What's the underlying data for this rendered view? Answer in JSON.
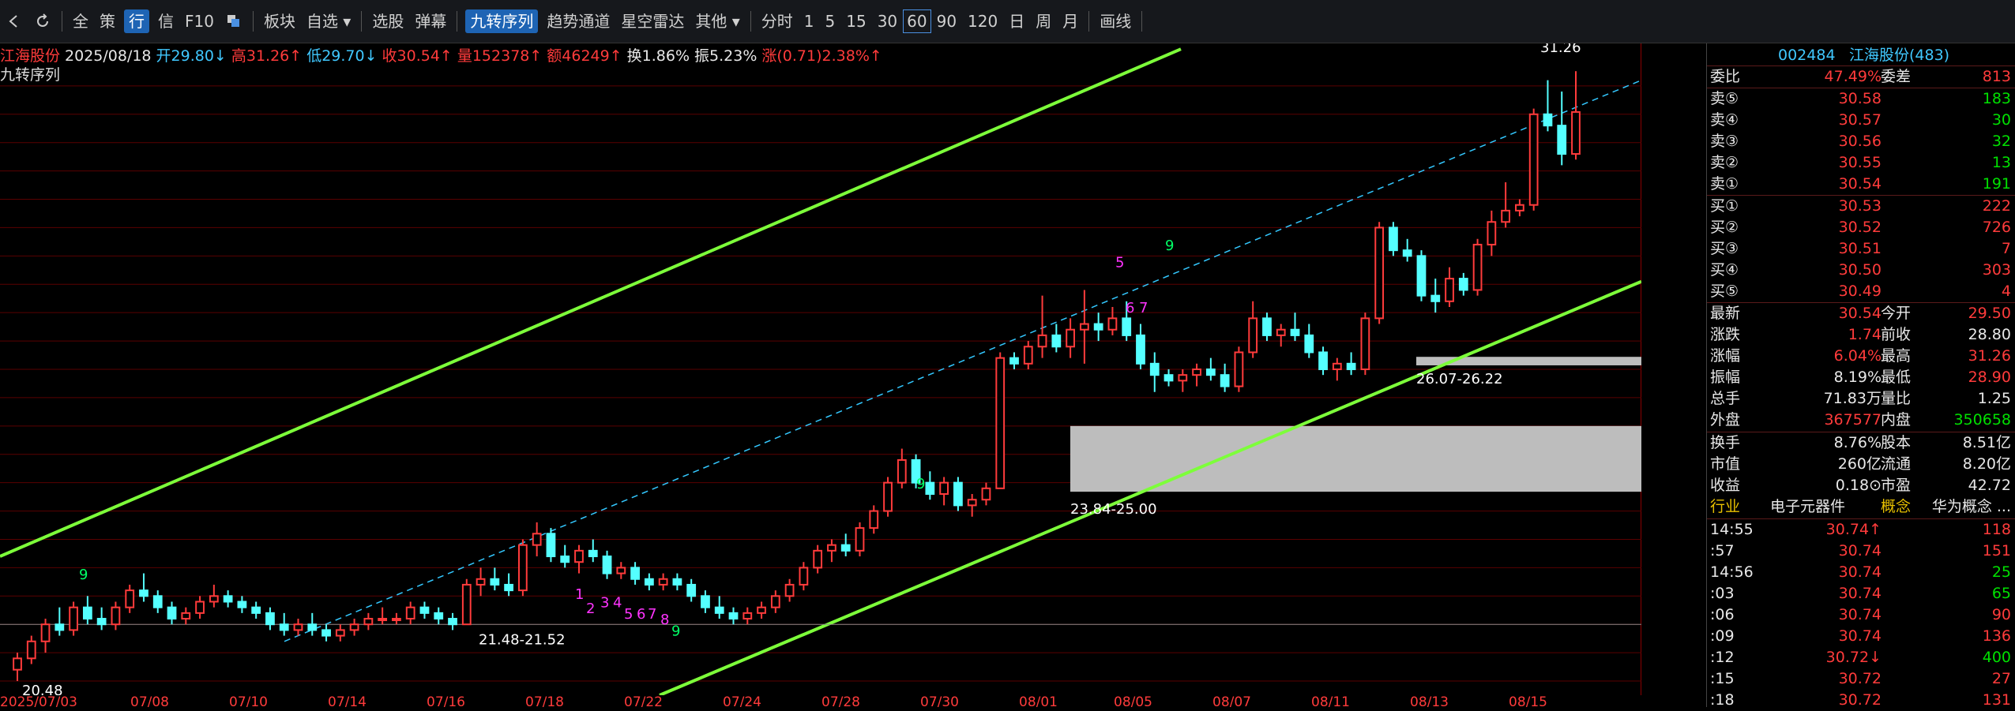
{
  "toolbar": {
    "items": [
      "全",
      "策",
      "行",
      "信",
      "F10"
    ],
    "menu": [
      "板块",
      "自选 ▾"
    ],
    "tools": [
      "选股",
      "弹幕"
    ],
    "indicators": [
      "九转序列",
      "趋势通道",
      "星空雷达",
      "其他 ▾"
    ],
    "periods": [
      "分时",
      "1",
      "5",
      "15",
      "30",
      "60",
      "90",
      "120",
      "日",
      "周",
      "月"
    ],
    "draw": "画线",
    "selected_period": "60",
    "selected_indicator": "九转序列"
  },
  "info": {
    "name": "江海股份",
    "date": "2025/08/18",
    "open": "开29.80↓",
    "high": "高31.26↑",
    "low": "低29.70↓",
    "close": "收30.54↑",
    "volume": "量152378↑",
    "amount": "额46249↑",
    "turnover": "换1.86%",
    "amplitude": "振5.23%",
    "change": "涨(0.71)2.38%↑",
    "indicator": "九转序列"
  },
  "chart_data": {
    "type": "candlestick",
    "ylim": [
      20.25,
      31.75
    ],
    "yticks": [
      "31.00",
      "30.50",
      "30.00",
      "29.50",
      "29.00",
      "28.50",
      "28.00",
      "27.50",
      "27.00",
      "26.50",
      "26.00",
      "25.50",
      "25.00",
      "24.50",
      "24.00",
      "23.50",
      "23.00",
      "22.50",
      "22.00",
      "21.50",
      "21.00",
      "20.50"
    ],
    "dates": [
      "2025/07/03",
      "07/08",
      "07/10",
      "07/14",
      "07/16",
      "07/18",
      "07/22",
      "07/24",
      "07/28",
      "07/30",
      "08/01",
      "08/05",
      "08/07",
      "08/11",
      "08/13",
      "08/15"
    ],
    "current_price": "30.54",
    "period_label": "60分钟",
    "candles": [
      [
        20.7,
        21.0,
        20.5,
        20.9
      ],
      [
        20.9,
        21.3,
        20.8,
        21.2
      ],
      [
        21.2,
        21.6,
        21.0,
        21.5
      ],
      [
        21.5,
        21.8,
        21.3,
        21.4
      ],
      [
        21.4,
        21.9,
        21.3,
        21.8
      ],
      [
        21.8,
        22.0,
        21.5,
        21.6
      ],
      [
        21.6,
        21.8,
        21.4,
        21.5
      ],
      [
        21.5,
        21.9,
        21.4,
        21.8
      ],
      [
        21.8,
        22.2,
        21.7,
        22.1
      ],
      [
        22.1,
        22.4,
        21.9,
        22.0
      ],
      [
        22.0,
        22.1,
        21.7,
        21.8
      ],
      [
        21.8,
        21.9,
        21.5,
        21.6
      ],
      [
        21.6,
        21.8,
        21.5,
        21.7
      ],
      [
        21.7,
        22.0,
        21.6,
        21.9
      ],
      [
        21.9,
        22.2,
        21.8,
        22.0
      ],
      [
        22.0,
        22.1,
        21.8,
        21.9
      ],
      [
        21.9,
        22.0,
        21.7,
        21.8
      ],
      [
        21.8,
        21.9,
        21.6,
        21.7
      ],
      [
        21.7,
        21.8,
        21.4,
        21.5
      ],
      [
        21.5,
        21.7,
        21.3,
        21.4
      ],
      [
        21.4,
        21.6,
        21.3,
        21.5
      ],
      [
        21.5,
        21.7,
        21.3,
        21.4
      ],
      [
        21.4,
        21.5,
        21.2,
        21.3
      ],
      [
        21.3,
        21.5,
        21.2,
        21.4
      ],
      [
        21.4,
        21.6,
        21.3,
        21.5
      ],
      [
        21.5,
        21.7,
        21.4,
        21.6
      ],
      [
        21.6,
        21.8,
        21.5,
        21.6
      ],
      [
        21.6,
        21.7,
        21.5,
        21.6
      ],
      [
        21.6,
        21.9,
        21.5,
        21.8
      ],
      [
        21.8,
        21.9,
        21.6,
        21.7
      ],
      [
        21.7,
        21.8,
        21.5,
        21.6
      ],
      [
        21.6,
        21.7,
        21.4,
        21.5
      ],
      [
        21.5,
        22.3,
        21.5,
        22.2
      ],
      [
        22.2,
        22.5,
        22.0,
        22.3
      ],
      [
        22.3,
        22.5,
        22.1,
        22.2
      ],
      [
        22.2,
        22.4,
        22.0,
        22.1
      ],
      [
        22.1,
        23.0,
        22.0,
        22.9
      ],
      [
        22.9,
        23.3,
        22.7,
        23.1
      ],
      [
        23.1,
        23.2,
        22.6,
        22.7
      ],
      [
        22.7,
        22.9,
        22.5,
        22.6
      ],
      [
        22.6,
        22.9,
        22.4,
        22.8
      ],
      [
        22.8,
        23.0,
        22.6,
        22.7
      ],
      [
        22.7,
        22.8,
        22.3,
        22.4
      ],
      [
        22.4,
        22.6,
        22.3,
        22.5
      ],
      [
        22.5,
        22.6,
        22.2,
        22.3
      ],
      [
        22.3,
        22.4,
        22.1,
        22.2
      ],
      [
        22.2,
        22.4,
        22.1,
        22.3
      ],
      [
        22.3,
        22.4,
        22.1,
        22.2
      ],
      [
        22.2,
        22.3,
        21.9,
        22.0
      ],
      [
        22.0,
        22.1,
        21.7,
        21.8
      ],
      [
        21.8,
        22.0,
        21.6,
        21.7
      ],
      [
        21.7,
        21.8,
        21.5,
        21.6
      ],
      [
        21.6,
        21.8,
        21.5,
        21.7
      ],
      [
        21.7,
        21.9,
        21.6,
        21.8
      ],
      [
        21.8,
        22.1,
        21.7,
        22.0
      ],
      [
        22.0,
        22.3,
        21.9,
        22.2
      ],
      [
        22.2,
        22.6,
        22.1,
        22.5
      ],
      [
        22.5,
        22.9,
        22.4,
        22.8
      ],
      [
        22.8,
        23.0,
        22.6,
        22.9
      ],
      [
        22.9,
        23.1,
        22.7,
        22.8
      ],
      [
        22.8,
        23.3,
        22.7,
        23.2
      ],
      [
        23.2,
        23.6,
        23.1,
        23.5
      ],
      [
        23.5,
        24.1,
        23.4,
        24.0
      ],
      [
        24.0,
        24.6,
        23.9,
        24.4
      ],
      [
        24.4,
        24.5,
        23.9,
        24.0
      ],
      [
        24.0,
        24.2,
        23.7,
        23.8
      ],
      [
        23.8,
        24.1,
        23.6,
        24.0
      ],
      [
        24.0,
        24.1,
        23.5,
        23.6
      ],
      [
        23.6,
        23.8,
        23.4,
        23.7
      ],
      [
        23.7,
        24.0,
        23.6,
        23.9
      ],
      [
        23.9,
        26.3,
        24.8,
        26.2
      ],
      [
        26.2,
        26.3,
        26.0,
        26.1
      ],
      [
        26.1,
        26.5,
        26.0,
        26.4
      ],
      [
        26.4,
        27.3,
        26.2,
        26.6
      ],
      [
        26.6,
        26.8,
        26.3,
        26.4
      ],
      [
        26.4,
        26.9,
        26.2,
        26.7
      ],
      [
        26.7,
        27.4,
        26.1,
        26.8
      ],
      [
        26.8,
        27.0,
        26.5,
        26.7
      ],
      [
        26.7,
        27.1,
        26.6,
        26.9
      ],
      [
        26.9,
        27.2,
        26.5,
        26.6
      ],
      [
        26.6,
        26.8,
        26.0,
        26.1
      ],
      [
        26.1,
        26.3,
        25.6,
        25.9
      ],
      [
        25.9,
        26.0,
        25.7,
        25.8
      ],
      [
        25.8,
        26.0,
        25.6,
        25.9
      ],
      [
        25.9,
        26.1,
        25.7,
        26.0
      ],
      [
        26.0,
        26.2,
        25.8,
        25.9
      ],
      [
        25.9,
        26.1,
        25.6,
        25.7
      ],
      [
        25.7,
        26.4,
        25.6,
        26.3
      ],
      [
        26.3,
        27.2,
        26.2,
        26.9
      ],
      [
        26.9,
        27.0,
        26.5,
        26.6
      ],
      [
        26.6,
        26.8,
        26.4,
        26.7
      ],
      [
        26.7,
        27.0,
        26.5,
        26.6
      ],
      [
        26.6,
        26.8,
        26.2,
        26.3
      ],
      [
        26.3,
        26.4,
        25.9,
        26.0
      ],
      [
        26.0,
        26.2,
        25.8,
        26.1
      ],
      [
        26.1,
        26.3,
        25.9,
        26.0
      ],
      [
        26.0,
        27.0,
        25.9,
        26.9
      ],
      [
        26.9,
        28.6,
        26.8,
        28.5
      ],
      [
        28.5,
        28.6,
        28.0,
        28.1
      ],
      [
        28.1,
        28.3,
        27.9,
        28.0
      ],
      [
        28.0,
        28.1,
        27.2,
        27.3
      ],
      [
        27.3,
        27.6,
        27.0,
        27.2
      ],
      [
        27.2,
        27.8,
        27.1,
        27.6
      ],
      [
        27.6,
        27.7,
        27.3,
        27.4
      ],
      [
        27.4,
        28.3,
        27.3,
        28.2
      ],
      [
        28.2,
        28.8,
        28.0,
        28.6
      ],
      [
        28.6,
        29.3,
        28.5,
        28.8
      ],
      [
        28.8,
        29.0,
        28.7,
        28.9
      ],
      [
        28.9,
        30.6,
        28.8,
        30.5
      ],
      [
        30.5,
        31.1,
        30.2,
        30.3
      ],
      [
        30.3,
        30.9,
        29.6,
        29.8
      ],
      [
        29.8,
        31.26,
        29.7,
        30.54
      ]
    ],
    "levels": [
      "31.26",
      "20.48",
      "26.07-26.22",
      "23.84-25.00",
      "21.48-21.52"
    ],
    "td_counts_top": [
      "9",
      "9",
      "5",
      "6",
      "7",
      "9"
    ],
    "td_counts_bottom": [
      "1",
      "2",
      "3",
      "4",
      "5",
      "6",
      "7",
      "8",
      "9"
    ]
  },
  "panel": {
    "code": "002484",
    "name": "江海股份(483)",
    "weibi_label": "委比",
    "weibi": "47.49%",
    "weicha_label": "委差",
    "weicha": "813",
    "sell": [
      {
        "label": "卖⑤",
        "price": "30.58",
        "vol": "183"
      },
      {
        "label": "卖④",
        "price": "30.57",
        "vol": "30"
      },
      {
        "label": "卖③",
        "price": "30.56",
        "vol": "32"
      },
      {
        "label": "卖②",
        "price": "30.55",
        "vol": "13"
      },
      {
        "label": "卖①",
        "price": "30.54",
        "vol": "191"
      }
    ],
    "buy": [
      {
        "label": "买①",
        "price": "30.53",
        "vol": "222"
      },
      {
        "label": "买②",
        "price": "30.52",
        "vol": "726"
      },
      {
        "label": "买③",
        "price": "30.51",
        "vol": "7"
      },
      {
        "label": "买④",
        "price": "30.50",
        "vol": "303"
      },
      {
        "label": "买⑤",
        "price": "30.49",
        "vol": "4"
      }
    ],
    "stats": [
      {
        "l1": "最新",
        "v1": "30.54",
        "c1": "red",
        "l2": "今开",
        "v2": "29.50",
        "c2": "red"
      },
      {
        "l1": "涨跌",
        "v1": "1.74",
        "c1": "red",
        "l2": "前收",
        "v2": "28.80",
        "c2": "white"
      },
      {
        "l1": "涨幅",
        "v1": "6.04%",
        "c1": "red",
        "l2": "最高",
        "v2": "31.26",
        "c2": "red"
      },
      {
        "l1": "振幅",
        "v1": "8.19%",
        "c1": "white",
        "l2": "最低",
        "v2": "28.90",
        "c2": "red"
      },
      {
        "l1": "总手",
        "v1": "71.83万",
        "c1": "white",
        "l2": "量比",
        "v2": "1.25",
        "c2": "white"
      },
      {
        "l1": "外盘",
        "v1": "367577",
        "c1": "red",
        "l2": "内盘",
        "v2": "350658",
        "c2": "green"
      }
    ],
    "stats2": [
      {
        "l1": "换手",
        "v1": "8.76%",
        "l2": "股本",
        "v2": "8.51亿"
      },
      {
        "l1": "市值",
        "v1": "260亿",
        "l2": "流通",
        "v2": "8.20亿"
      },
      {
        "l1": "收益",
        "v1": "0.18⊙",
        "l2": "市盈",
        "v2": "42.72"
      }
    ],
    "industry_label": "行业",
    "industry": "电子元器件",
    "concept_label": "概念",
    "concept": "华为概念 ...",
    "ticks": [
      {
        "t": "14:55",
        "p": "30.74↑",
        "v": "118",
        "c": "red"
      },
      {
        "t": ":57",
        "p": "30.74",
        "v": "151",
        "c": "red"
      },
      {
        "t": "14:56",
        "p": "30.74",
        "v": "25",
        "c": "green"
      },
      {
        "t": ":03",
        "p": "30.74",
        "v": "65",
        "c": "green"
      },
      {
        "t": ":06",
        "p": "30.74",
        "v": "90",
        "c": "red"
      },
      {
        "t": ":09",
        "p": "30.74",
        "v": "136",
        "c": "red"
      },
      {
        "t": ":12",
        "p": "30.72↓",
        "v": "400",
        "c": "green"
      },
      {
        "t": ":15",
        "p": "30.72",
        "v": "27",
        "c": "red"
      },
      {
        "t": ":18",
        "p": "30.72",
        "v": "131",
        "c": "red"
      }
    ]
  },
  "colors": {
    "up": "#ff3b3b",
    "down": "#54ffff",
    "grid": "#5a0000",
    "channel": "#7dff3a",
    "td_up": "#ff33ff",
    "td_nine": "#00ff66",
    "box": "#bdbdbd"
  }
}
